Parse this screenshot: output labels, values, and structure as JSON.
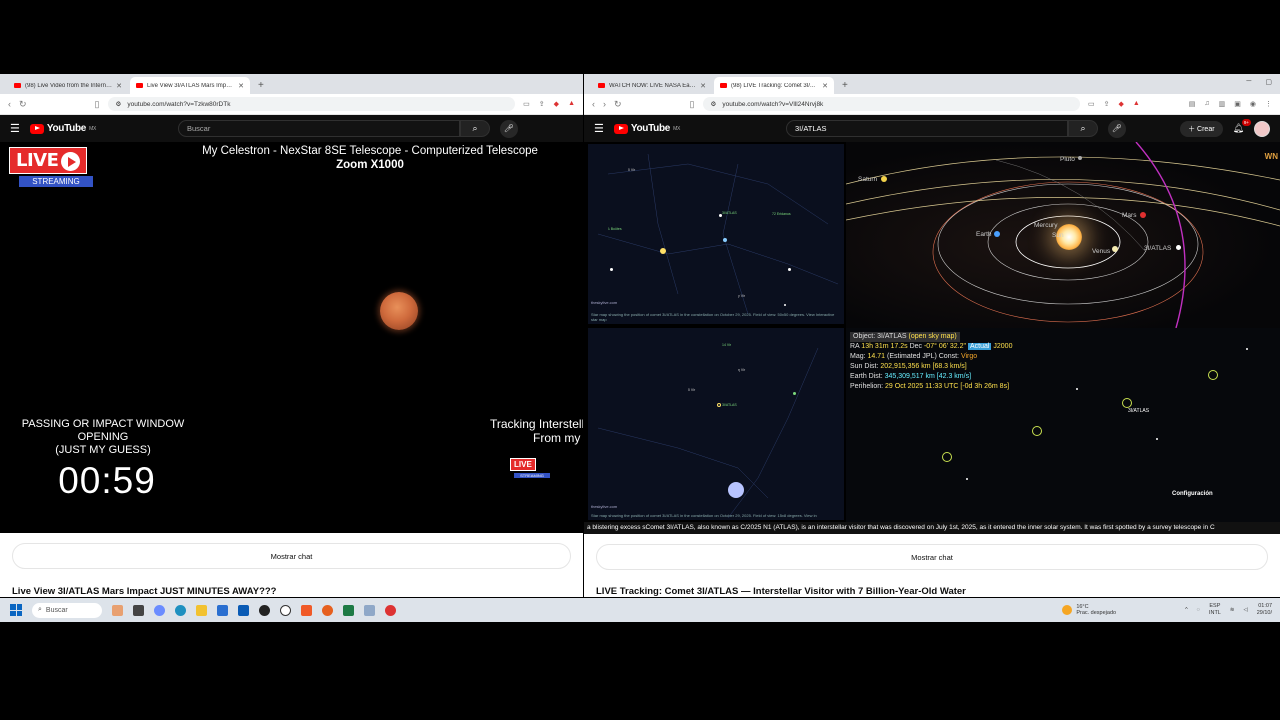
{
  "left_window": {
    "tabs": [
      {
        "label": "(98) Live Video from the International..."
      },
      {
        "label": "Live View 3I/ATLAS Mars Impact..."
      }
    ],
    "url": "youtube.com/watch?v=Tzkw80rDTk",
    "yt": {
      "logo_text": "YouTube",
      "region": "MX",
      "search_placeholder": "Buscar"
    },
    "video": {
      "live_text": "LIVE",
      "streaming_text": "STREAMING",
      "scope_line1": "My Celestron - NexStar 8SE Telescope - Computerized Telescope",
      "scope_line2": "Zoom X1000",
      "passing_line1": "PASSING OR IMPACT WINDOW",
      "passing_line2": "OPENING",
      "passing_line3": "(JUST MY GUESS)",
      "countdown": "00:59",
      "tracking_line1": "Tracking Interstell",
      "tracking_line2": "From my"
    },
    "chat_button": "Mostrar chat",
    "video_title": "Live View 3I/ATLAS Mars Impact JUST MINUTES AWAY???"
  },
  "right_window": {
    "tabs": [
      {
        "label": "WATCH NOW: LIVE NASA Earth F..."
      },
      {
        "label": "(98) LIVE Tracking: Comet 3I/..."
      }
    ],
    "url": "youtube.com/watch?v=Vlll24Nrvj8k",
    "yt": {
      "logo_text": "YouTube",
      "region": "MX",
      "search_value": "3I/ATLAS",
      "create_label": "Crear",
      "notif_count": "9+"
    },
    "skymap": {
      "site": "theskylive.com",
      "caption_top": "Star map showing the position of comet 3I/ATLAS in the constellation on October 29, 2025. Field of view: 50x50 degrees. View Interactive star map",
      "caption_bottom": "Star map showing the position of comet 3I/ATLAS in the constellation on October 29, 2025. Field of view: 15x8 degrees. View in"
    },
    "solar": {
      "planets": [
        "Pluto",
        "Saturn",
        "Mars",
        "Earth",
        "Mercury",
        "Sun",
        "Venus",
        "3I/ATLAS"
      ],
      "brand": "WN"
    },
    "info": {
      "object": "Object: 3I/ATLAS",
      "object_link": "(open sky map)",
      "ra_label": "RA",
      "ra_value": "13h 31m 17.2s",
      "dec_label": "Dec",
      "dec_value": "-07° 06' 32.2\"",
      "epoch_hl": "Actual",
      "epoch": "J2000",
      "mag_label": "Mag:",
      "mag_value": "14.71",
      "mag_note": "(Estimated JPL)",
      "const_label": "Const:",
      "const_value": "Virgo",
      "sun_label": "Sun Dist:",
      "sun_value": "202,915,356 km [68.3 km/s]",
      "earth_label": "Earth Dist:",
      "earth_value": "345,309,517 km [42.3 km/s]",
      "peri_label": "Perihelion:",
      "peri_value": "29 Oct 2025 11:33 UTC [-0d 3h 26m 8s]",
      "comet_label": "3I/ATLAS",
      "config_label": "Configuración"
    },
    "description": "a blistering excess sComet 3I/ATLAS, also known as C/2025 N1 (ATLAS), is an interstellar visitor that was discovered on July 1st, 2025, as it entered the inner solar system. It was first spotted by a survey telescope in C",
    "chat_button": "Mostrar chat",
    "video_title": "LIVE Tracking: Comet 3I/ATLAS — Interstellar Visitor with 7 Billion-Year-Old Water"
  },
  "taskbar": {
    "search_placeholder": "Buscar",
    "weather_temp": "16°C",
    "weather_desc": "Prac. despejado",
    "lang1": "ESP",
    "lang2": "INTL",
    "time": "01:07",
    "date": "29/10/"
  },
  "colors": {
    "live_red": "#e52b2b",
    "streaming_blue": "#3353c5",
    "yt_red": "#ff0000",
    "info_yellow": "#ffe14d"
  }
}
